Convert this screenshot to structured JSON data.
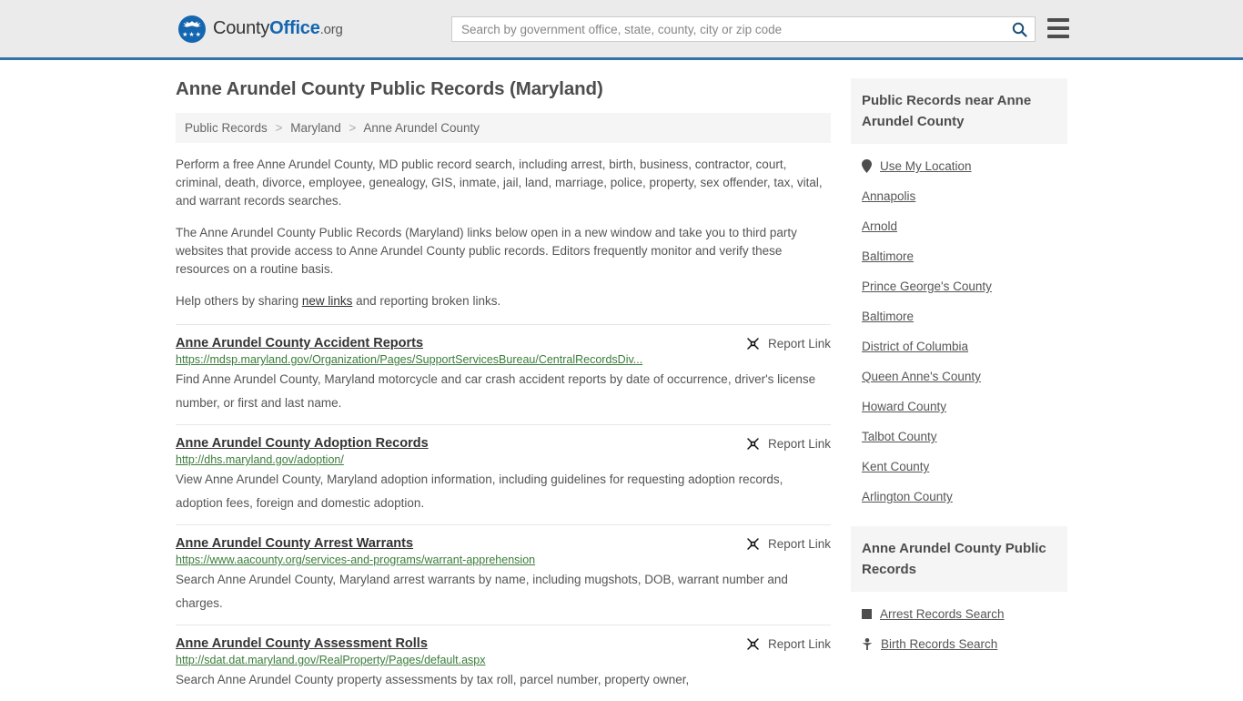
{
  "header": {
    "logo": {
      "text_part1": "County",
      "text_part2": "Office",
      "text_part3": ".org",
      "icon": "eagle-seal-icon"
    },
    "search": {
      "placeholder": "Search by government office, state, county, city or zip code",
      "value": "",
      "button_icon": "search-icon"
    },
    "menu_icon": "hamburger-menu-icon",
    "background_color": "#ebebeb",
    "accent_color": "#3273a8"
  },
  "page": {
    "title": "Anne Arundel County Public Records (Maryland)"
  },
  "breadcrumb": {
    "items": [
      {
        "label": "Public Records"
      },
      {
        "label": "Maryland"
      },
      {
        "label": "Anne Arundel County"
      }
    ],
    "separator": ">"
  },
  "intro": {
    "p1": "Perform a free Anne Arundel County, MD public record search, including arrest, birth, business, contractor, court, criminal, death, divorce, employee, genealogy, GIS, inmate, jail, land, marriage, police, property, sex offender, tax, vital, and warrant records searches.",
    "p2": "The Anne Arundel County Public Records (Maryland) links below open in a new window and take you to third party websites that provide access to Anne Arundel County public records. Editors frequently monitor and verify these resources on a routine basis.",
    "p3_prefix": "Help others by sharing ",
    "p3_link": "new links",
    "p3_suffix": " and reporting broken links."
  },
  "report_link_label": "Report Link",
  "report_link_icon": "broken-link-icon",
  "records": [
    {
      "title": "Anne Arundel County Accident Reports",
      "url": "https://mdsp.maryland.gov/Organization/Pages/SupportServicesBureau/CentralRecordsDiv...",
      "description": "Find Anne Arundel County, Maryland motorcycle and car crash accident reports by date of occurrence, driver's license number, or first and last name."
    },
    {
      "title": "Anne Arundel County Adoption Records",
      "url": "http://dhs.maryland.gov/adoption/",
      "description": "View Anne Arundel County, Maryland adoption information, including guidelines for requesting adoption records, adoption fees, foreign and domestic adoption."
    },
    {
      "title": "Anne Arundel County Arrest Warrants",
      "url": "https://www.aacounty.org/services-and-programs/warrant-apprehension",
      "description": "Search Anne Arundel County, Maryland arrest warrants by name, including mugshots, DOB, warrant number and charges."
    },
    {
      "title": "Anne Arundel County Assessment Rolls",
      "url": "http://sdat.dat.maryland.gov/RealProperty/Pages/default.aspx",
      "description": "Search Anne Arundel County property assessments by tax roll, parcel number, property owner,"
    }
  ],
  "sidebar": {
    "nearby_card": {
      "heading": "Public Records near Anne Arundel County",
      "items": [
        {
          "label": "Use My Location",
          "icon": "map-pin-icon"
        },
        {
          "label": "Annapolis",
          "icon": ""
        },
        {
          "label": "Arnold",
          "icon": ""
        },
        {
          "label": "Baltimore",
          "icon": ""
        },
        {
          "label": "Prince George's County",
          "icon": ""
        },
        {
          "label": "Baltimore",
          "icon": ""
        },
        {
          "label": "District of Columbia",
          "icon": ""
        },
        {
          "label": "Queen Anne's County",
          "icon": ""
        },
        {
          "label": "Howard County",
          "icon": ""
        },
        {
          "label": "Talbot County",
          "icon": ""
        },
        {
          "label": "Kent County",
          "icon": ""
        },
        {
          "label": "Arlington County",
          "icon": ""
        }
      ]
    },
    "records_card": {
      "heading": "Anne Arundel County Public Records",
      "items": [
        {
          "label": "Arrest Records Search",
          "icon": "fingerprint-square-icon"
        },
        {
          "label": "Birth Records Search",
          "icon": "baby-icon"
        }
      ]
    }
  }
}
